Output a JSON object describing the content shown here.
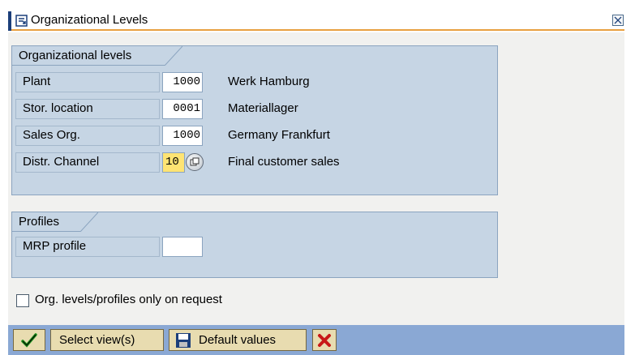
{
  "window": {
    "title": "Organizational Levels",
    "close_label": "close"
  },
  "org_levels": {
    "title": "Organizational levels",
    "fields": [
      {
        "label": "Plant",
        "value": "1000",
        "description": "Werk Hamburg"
      },
      {
        "label": "Stor. location",
        "value": "0001",
        "description": "Materiallager"
      },
      {
        "label": "Sales Org.",
        "value": "1000",
        "description": "Germany Frankfurt"
      },
      {
        "label": "Distr. Channel",
        "value": "10",
        "description": "Final customer sales"
      }
    ]
  },
  "profiles": {
    "title": "Profiles",
    "fields": [
      {
        "label": "MRP profile",
        "value": ""
      }
    ]
  },
  "option": {
    "label": "Org. levels/profiles only on request",
    "checked": false
  },
  "toolbar": {
    "confirm_icon": "checkmark-icon",
    "select_views_label": "Select view(s)",
    "default_values_label": "Default values",
    "default_values_icon": "save-disk-icon",
    "cancel_icon": "cancel-x-icon"
  },
  "colors": {
    "group_bg": "#c6d5e4",
    "toolbar_bg": "#8aa8d4",
    "highlight_input": "#ffe473",
    "button_bg": "#e8dcb0",
    "accent_orange": "#e8a040"
  }
}
